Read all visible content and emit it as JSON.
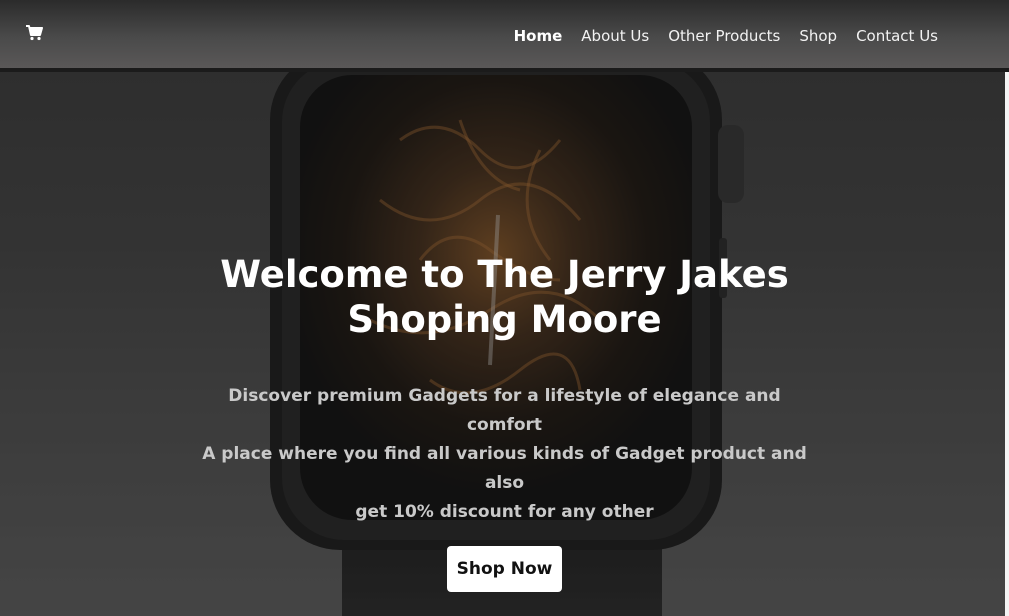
{
  "navbar": {
    "cart_icon": "shopping-cart-icon",
    "links": [
      {
        "label": "Home",
        "active": true
      },
      {
        "label": "About Us",
        "active": false
      },
      {
        "label": "Other Products",
        "active": false
      },
      {
        "label": "Shop",
        "active": false
      },
      {
        "label": "Contact Us",
        "active": false
      }
    ]
  },
  "hero": {
    "title_line1": "Welcome to The Jerry Jakes",
    "title_line2": "Shoping Moore",
    "subtitle_line1": "Discover premium Gadgets for a lifestyle of elegance and comfort",
    "subtitle_line2": "A place where you find all various kinds of Gadget product and also",
    "subtitle_line3": "get 10% discount for any other",
    "cta_label": "Shop Now"
  },
  "colors": {
    "nav_text": "#f2f2f2",
    "hero_title": "#ffffff",
    "hero_subtitle": "#c9c9c9",
    "button_bg": "#ffffff"
  }
}
